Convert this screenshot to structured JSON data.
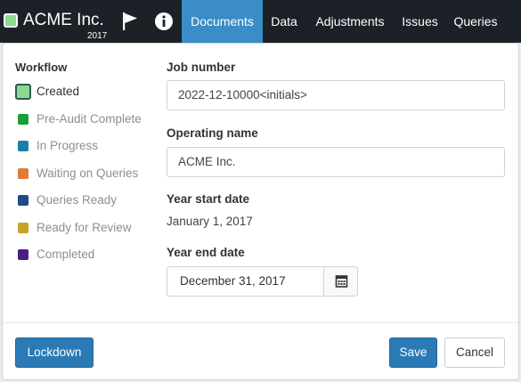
{
  "navbar": {
    "brand": {
      "name": "ACME Inc.",
      "year": "2017",
      "swatch_color": "#8fd88f",
      "icon": "status-swatch-icon"
    },
    "icons": [
      {
        "name": "flag-icon"
      },
      {
        "name": "info-icon"
      }
    ],
    "tabs": [
      {
        "label": "Documents",
        "active": true
      },
      {
        "label": "Data",
        "active": false
      },
      {
        "label": "Adjustments",
        "active": false
      },
      {
        "label": "Issues",
        "active": false
      },
      {
        "label": "Queries",
        "active": false
      }
    ],
    "active_color": "#3a8dc6",
    "background": "#1c2128"
  },
  "workflow": {
    "title": "Workflow",
    "items": [
      {
        "label": "Created",
        "color": "#8fd88f",
        "selected": true
      },
      {
        "label": "Pre-Audit Complete",
        "color": "#1a9e3a",
        "selected": false
      },
      {
        "label": "In Progress",
        "color": "#1a80a8",
        "selected": false
      },
      {
        "label": "Waiting on Queries",
        "color": "#e07b35",
        "selected": false
      },
      {
        "label": "Queries Ready",
        "color": "#1f4b85",
        "selected": false
      },
      {
        "label": "Ready for Review",
        "color": "#c9a22b",
        "selected": false
      },
      {
        "label": "Completed",
        "color": "#4a1f85",
        "selected": false
      }
    ]
  },
  "form": {
    "job_number": {
      "label": "Job number",
      "value": "2022-12-10000<initials>"
    },
    "operating_name": {
      "label": "Operating name",
      "value": "ACME Inc."
    },
    "year_start": {
      "label": "Year start date",
      "value": "January 1, 2017"
    },
    "year_end": {
      "label": "Year end date",
      "value": "December 31, 2017",
      "icon": "calendar-icon"
    }
  },
  "footer": {
    "lockdown_label": "Lockdown",
    "save_label": "Save",
    "cancel_label": "Cancel"
  }
}
